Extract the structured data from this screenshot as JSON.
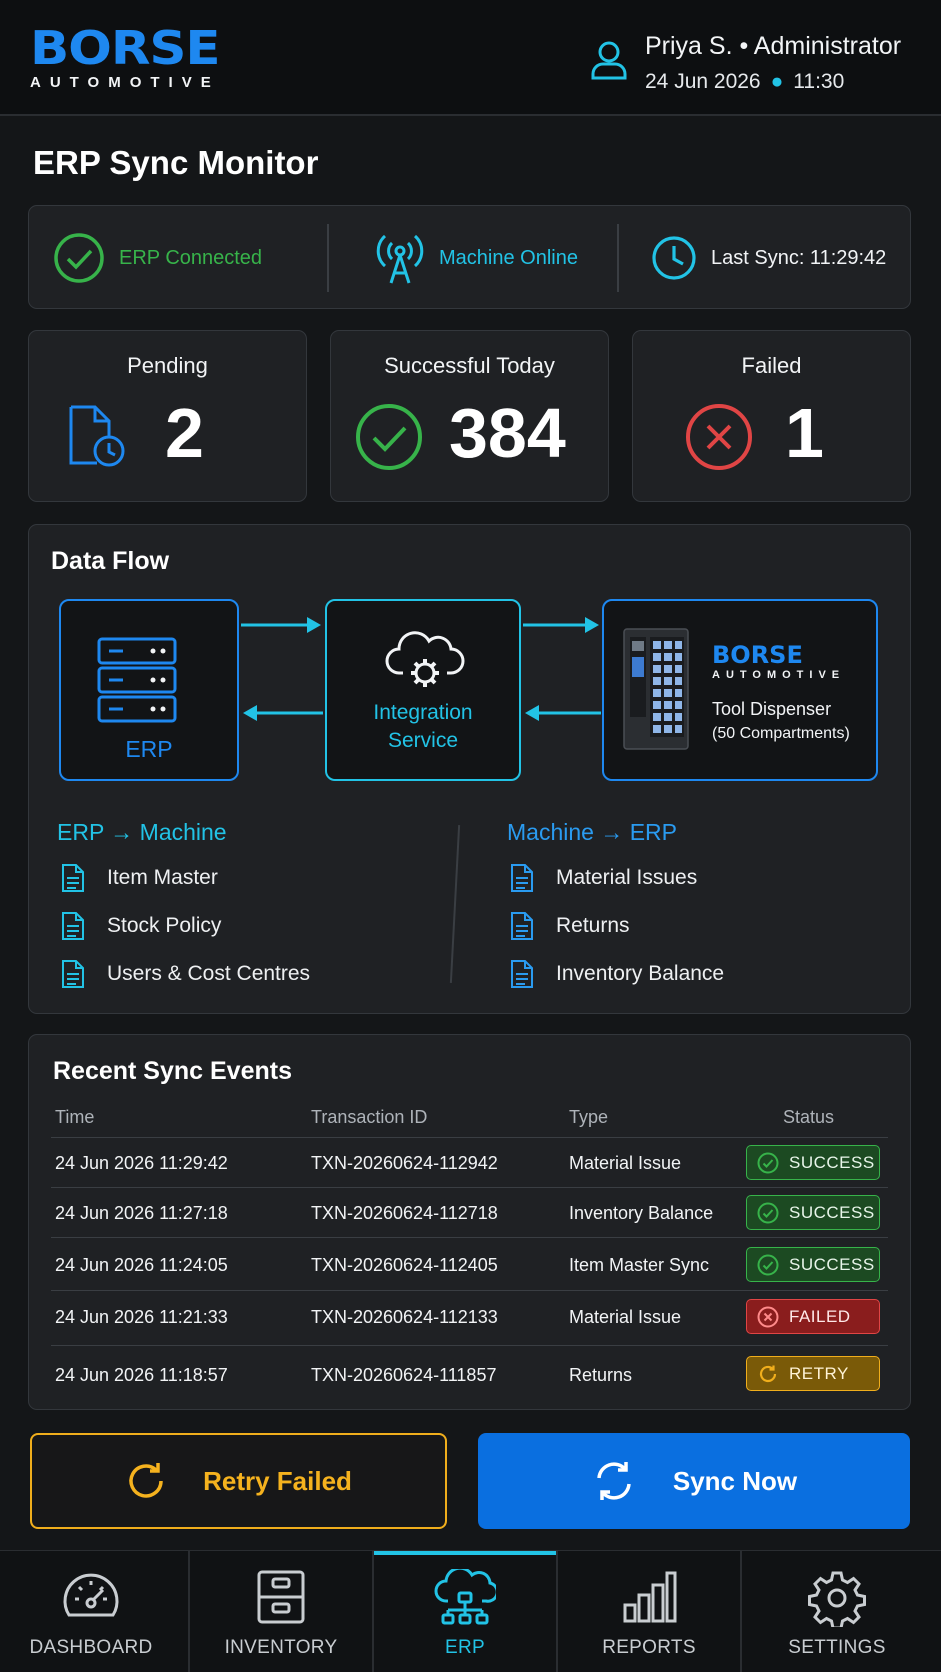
{
  "header": {
    "brand": "BORSE",
    "brand_sub": "AUTOMOTIVE",
    "user": "Priya S. • Administrator",
    "date": "24 Jun 2026",
    "time": "11:30"
  },
  "page_title": "ERP Sync Monitor",
  "status": {
    "erp": "ERP Connected",
    "machine": "Machine Online",
    "last_sync": "Last Sync: 11:29:42"
  },
  "stats": {
    "pending_label": "Pending",
    "pending_value": "2",
    "success_label": "Successful Today",
    "success_value": "384",
    "failed_label": "Failed",
    "failed_value": "1"
  },
  "flow": {
    "title": "Data Flow",
    "erp_label": "ERP",
    "int_line1": "Integration",
    "int_line2": "Service",
    "mach_brand": "BORSE",
    "mach_brand_sub": "AUTOMOTIVE",
    "mach_title": "Tool Dispenser",
    "mach_sub": "(50 Compartments)",
    "left_title": "ERP → Machine",
    "left_items": [
      "Item Master",
      "Stock Policy",
      "Users & Cost Centres"
    ],
    "right_title": "Machine → ERP",
    "right_items": [
      "Material Issues",
      "Returns",
      "Inventory Balance"
    ]
  },
  "events": {
    "title": "Recent Sync Events",
    "columns": [
      "Time",
      "Transaction ID",
      "Type",
      "Status"
    ],
    "rows": [
      {
        "time": "24 Jun 2026 11:29:42",
        "txn": "TXN-20260624-112942",
        "type": "Material Issue",
        "status": "SUCCESS"
      },
      {
        "time": "24 Jun 2026 11:27:18",
        "txn": "TXN-20260624-112718",
        "type": "Inventory Balance",
        "status": "SUCCESS"
      },
      {
        "time": "24 Jun 2026 11:24:05",
        "txn": "TXN-20260624-112405",
        "type": "Item Master Sync",
        "status": "SUCCESS"
      },
      {
        "time": "24 Jun 2026 11:21:33",
        "txn": "TXN-20260624-112133",
        "type": "Material Issue",
        "status": "FAILED"
      },
      {
        "time": "24 Jun 2026 11:18:57",
        "txn": "TXN-20260624-111857",
        "type": "Returns",
        "status": "RETRY"
      }
    ]
  },
  "actions": {
    "retry": "Retry Failed",
    "sync": "Sync Now"
  },
  "nav": {
    "items": [
      "DASHBOARD",
      "INVENTORY",
      "ERP",
      "REPORTS",
      "SETTINGS"
    ],
    "active": "ERP"
  },
  "colors": {
    "brand_blue": "#1e88f0",
    "accent_cyan": "#22c3e6",
    "success": "#37b34a",
    "failed": "#e04545",
    "retry": "#f0ae1c"
  }
}
